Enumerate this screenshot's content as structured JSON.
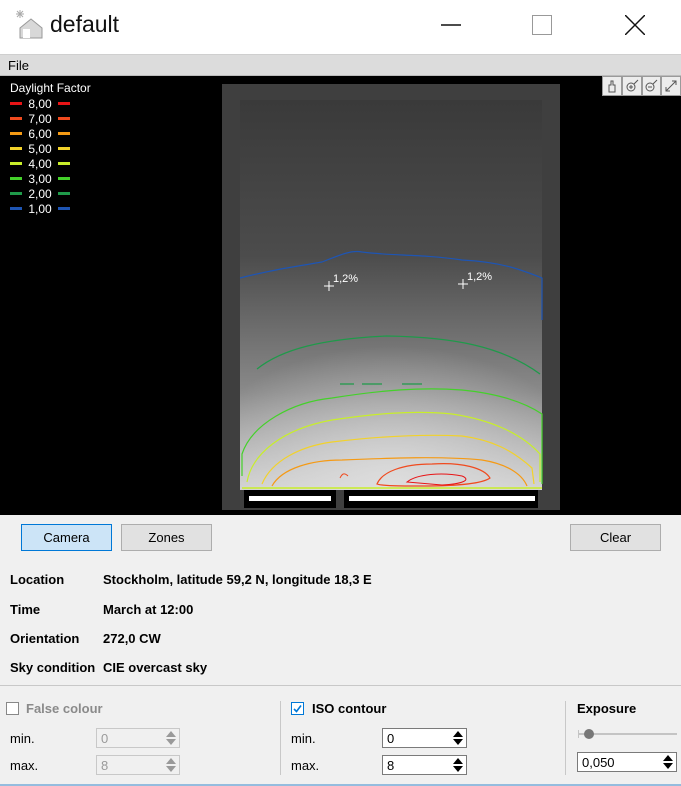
{
  "window": {
    "title": "default"
  },
  "menu": {
    "file": "File"
  },
  "viewport": {
    "legend": {
      "title": "Daylight Factor",
      "items": [
        {
          "value": "8,00",
          "color": "#e81416"
        },
        {
          "value": "7,00",
          "color": "#f04a1e"
        },
        {
          "value": "6,00",
          "color": "#f59a14"
        },
        {
          "value": "5,00",
          "color": "#f2d22a"
        },
        {
          "value": "4,00",
          "color": "#c8ee2a"
        },
        {
          "value": "3,00",
          "color": "#44d12a"
        },
        {
          "value": "2,00",
          "color": "#1f9a4a"
        },
        {
          "value": "1,00",
          "color": "#1e55b4"
        }
      ]
    },
    "markers": [
      "1,2%",
      "1,2%"
    ],
    "tools": [
      "pan-icon",
      "zoom-in-icon",
      "zoom-out-icon",
      "fit-icon"
    ]
  },
  "buttons": {
    "camera": "Camera",
    "zones": "Zones",
    "clear": "Clear"
  },
  "info": {
    "location_label": "Location",
    "location_value": "Stockholm, latitude 59,2 N, longitude 18,3 E",
    "time_label": "Time",
    "time_value": "March at 12:00",
    "orientation_label": "Orientation",
    "orientation_value": "272,0 CW",
    "sky_label": "Sky condition",
    "sky_value": "CIE overcast sky"
  },
  "false_colour": {
    "label": "False colour",
    "checked": false,
    "min_label": "min.",
    "min_value": "0",
    "max_label": "max.",
    "max_value": "8"
  },
  "iso_contour": {
    "label": "ISO contour",
    "checked": true,
    "min_label": "min.",
    "min_value": "0",
    "max_label": "max.",
    "max_value": "8"
  },
  "exposure": {
    "label": "Exposure",
    "value": "0,050"
  }
}
